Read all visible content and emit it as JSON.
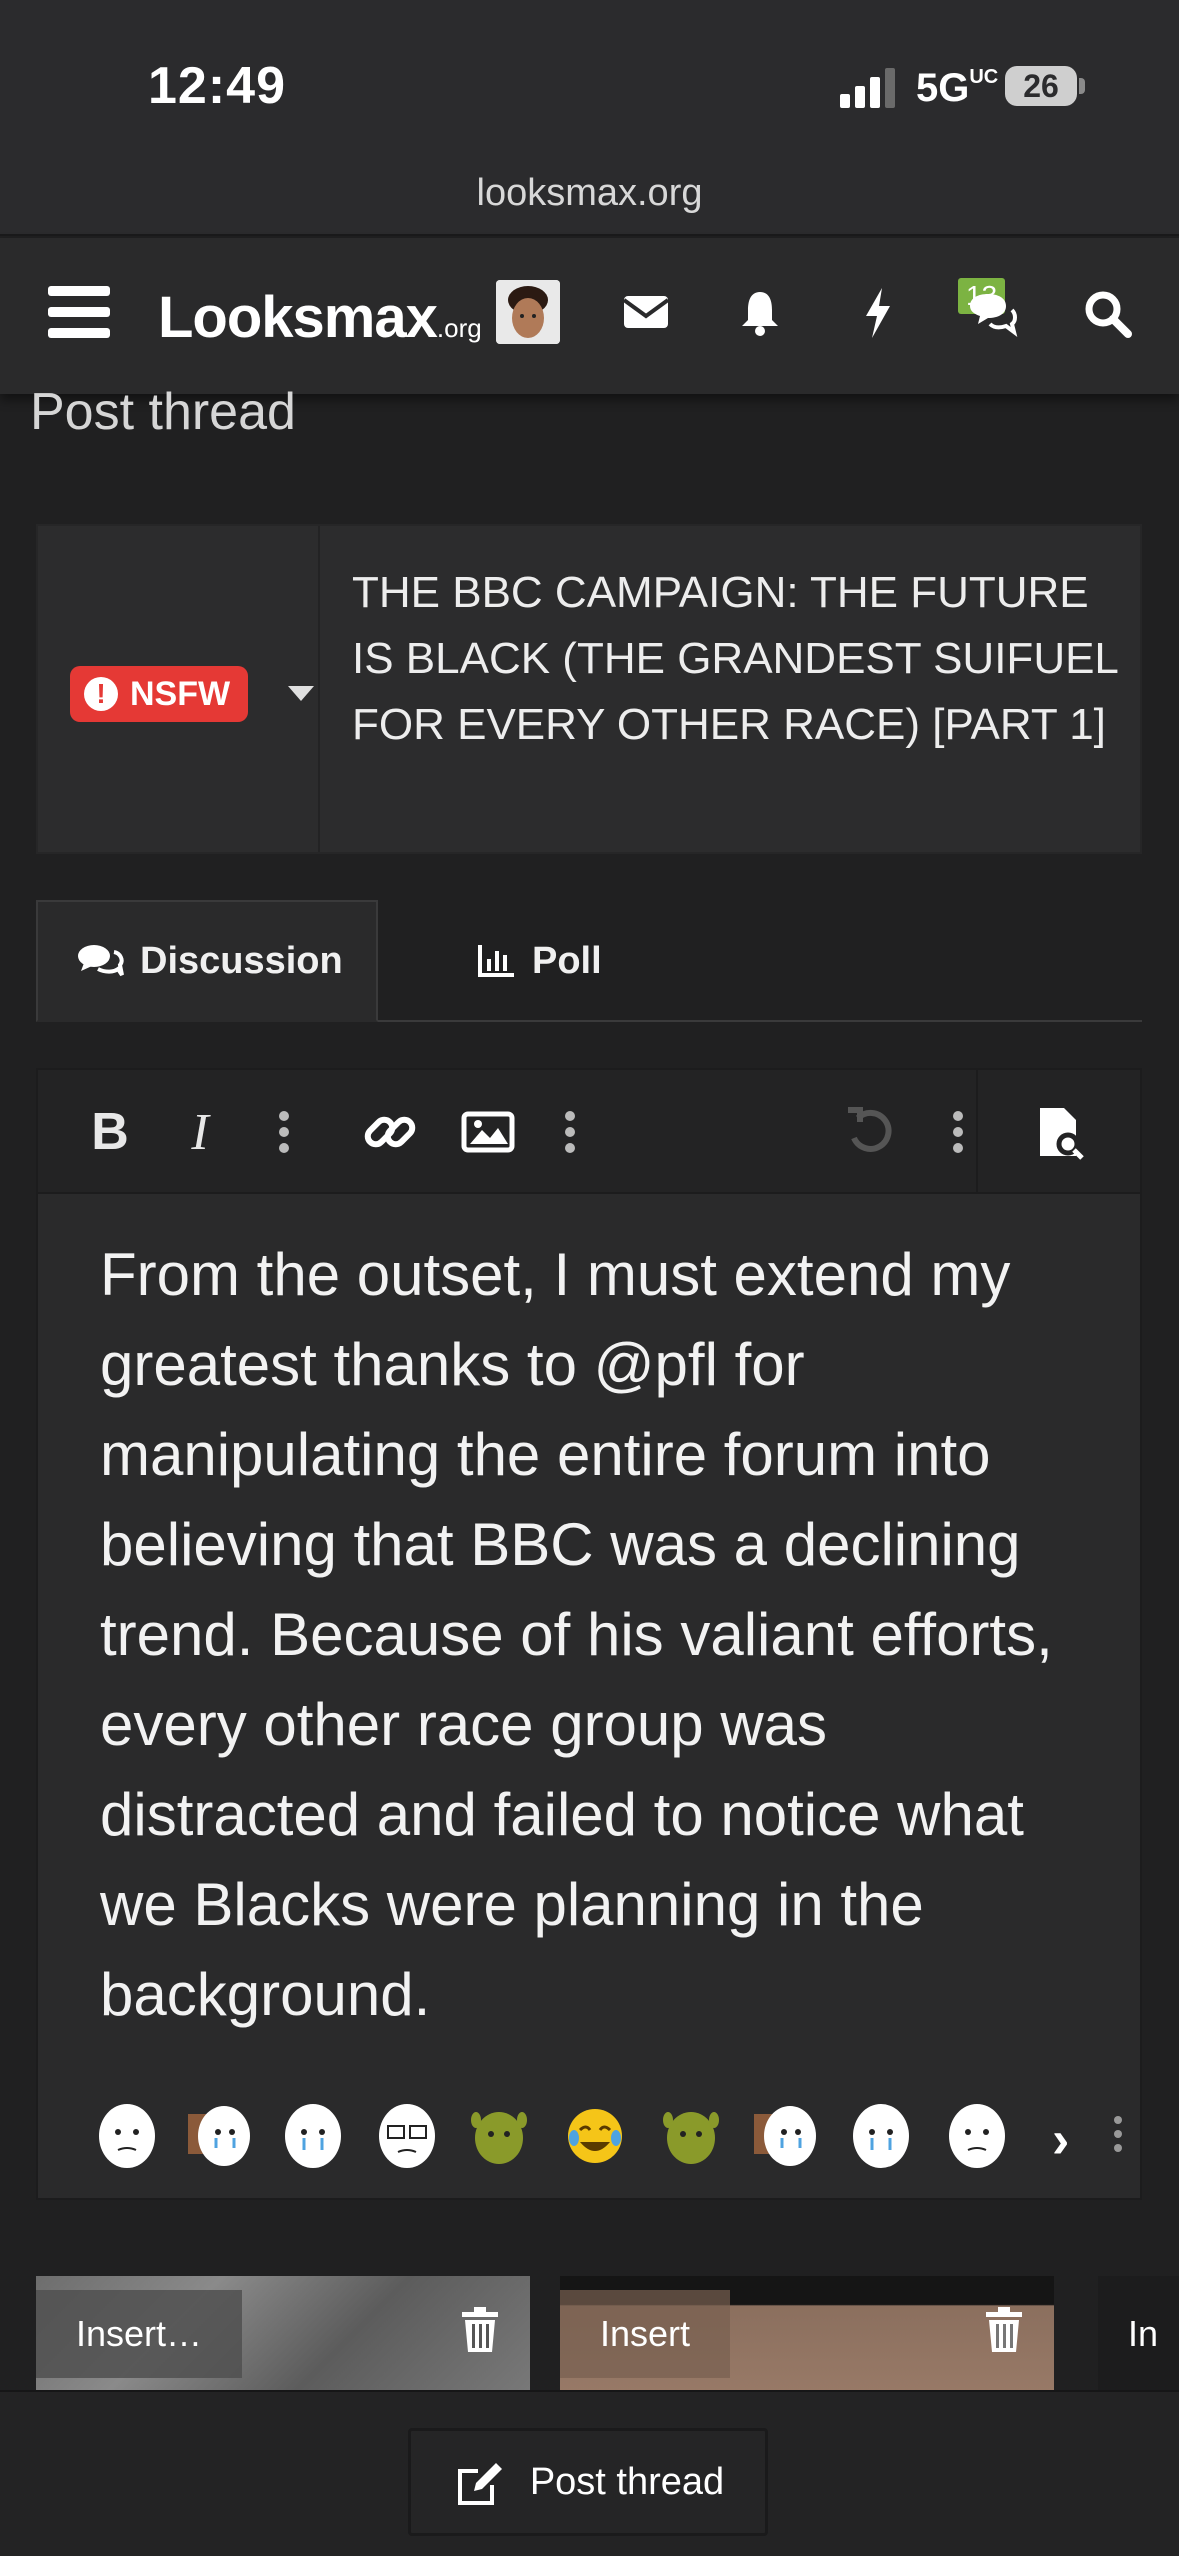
{
  "status": {
    "time": "12:49",
    "network": "5G",
    "network_suffix": "UC",
    "battery": "26"
  },
  "browser": {
    "url": "looksmax.org"
  },
  "nav": {
    "logo_main": "Looksmax",
    "logo_suffix": ".org",
    "conversations_badge": "13",
    "icons": [
      "menu-icon",
      "avatar",
      "envelope-icon",
      "bell-icon",
      "bolt-icon",
      "comments-icon",
      "search-icon"
    ]
  },
  "page": {
    "heading": "Post thread"
  },
  "thread": {
    "prefix": "NSFW",
    "title": "THE BBC CAMPAIGN: THE FUTURE IS BLACK (THE GRANDEST SUIFUEL FOR EVERY OTHER RACE) [PART 1]"
  },
  "tabs": [
    {
      "label": "Discussion",
      "active": true
    },
    {
      "label": "Poll",
      "active": false
    }
  ],
  "editor": {
    "body": "From the outset, I must extend my greatest thanks to @pfl for manipulating the entire forum into believing that BBC was a declining trend. Because of his valiant efforts, every other race group was distracted and failed to notice what we Blacks were planning in the background.",
    "toolbar": [
      "bold",
      "italic",
      "more",
      "link",
      "image",
      "more",
      "undo",
      "more",
      "preview"
    ]
  },
  "emojis": [
    "wojak",
    "crying-wojak",
    "crying-wojak",
    "glasses-wojak",
    "shrek",
    "laughing-crying",
    "shrek",
    "crying-wojak",
    "crying-wojak",
    "wojak"
  ],
  "attachments": [
    {
      "label": "Insert…"
    },
    {
      "label": "Insert"
    },
    {
      "label": "In"
    }
  ],
  "footer": {
    "post_button": "Post thread"
  },
  "colors": {
    "accent_red": "#e53935",
    "badge_green": "#7cb342",
    "background": "#202021"
  }
}
